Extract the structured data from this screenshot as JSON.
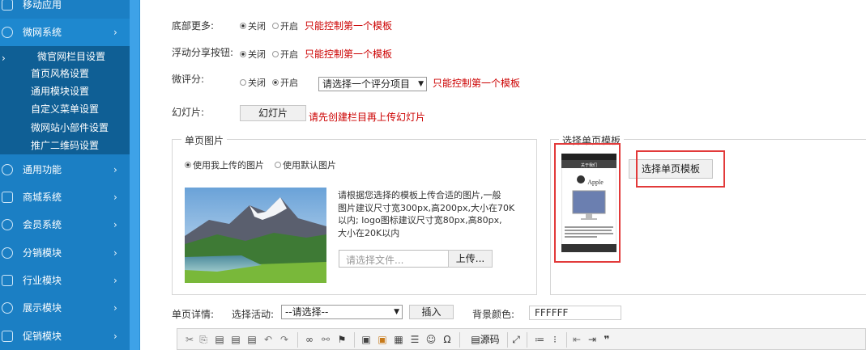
{
  "sidebar": {
    "menu_top": "移动应用",
    "menu_weiwang": "微网系统",
    "submenu": [
      "微官网栏目设置",
      "首页风格设置",
      "通用模块设置",
      "自定义菜单设置",
      "微网站小部件设置",
      "推广二维码设置"
    ],
    "menus": [
      "通用功能",
      "商城系统",
      "会员系统",
      "分销模块",
      "行业模块",
      "展示模块",
      "促销模块"
    ]
  },
  "form": {
    "bottom_more_label": "底部更多:",
    "float_share_label": "浮动分享按钮:",
    "review_label": "微评分:",
    "slideshow_label": "幻灯片:",
    "off": "关闭",
    "on": "开启",
    "only_first_template": "只能控制第一个模板",
    "review_select": "请选择一个评分项目",
    "slideshow_button": "幻灯片",
    "slideshow_hint": "请先创建栏目再上传幻灯片"
  },
  "single_image": {
    "title": "单页图片",
    "use_uploaded": "使用我上传的图片",
    "use_default": "使用默认图片",
    "desc_line1": "请根据您选择的模板上传合适的图片,一般",
    "desc_line2": "图片建议尺寸宽300px,高200px,大小在70K",
    "desc_line3": "以内; logo图标建议尺寸宽80px,高80px,",
    "desc_line4": "大小在20K以内",
    "file_placeholder": "请选择文件...",
    "upload_button": "上传..."
  },
  "template": {
    "title": "选择单页模板",
    "button": "选择单页模板",
    "phone_header": "关于我们",
    "phone_brand": "Apple"
  },
  "detail": {
    "label": "单页详情:",
    "activity_label": "选择活动:",
    "activity_select": "--请选择--",
    "insert_button": "插入",
    "bg_color_label": "背景颜色:",
    "bg_color_value": "FFFFFF"
  },
  "toolbar": {
    "source_label": "源码"
  },
  "colors": {
    "sidebar": "#1b7fc4",
    "submenu": "#0f5f95",
    "accent_red": "#cc0000",
    "highlight_box": "#e23a3a"
  }
}
